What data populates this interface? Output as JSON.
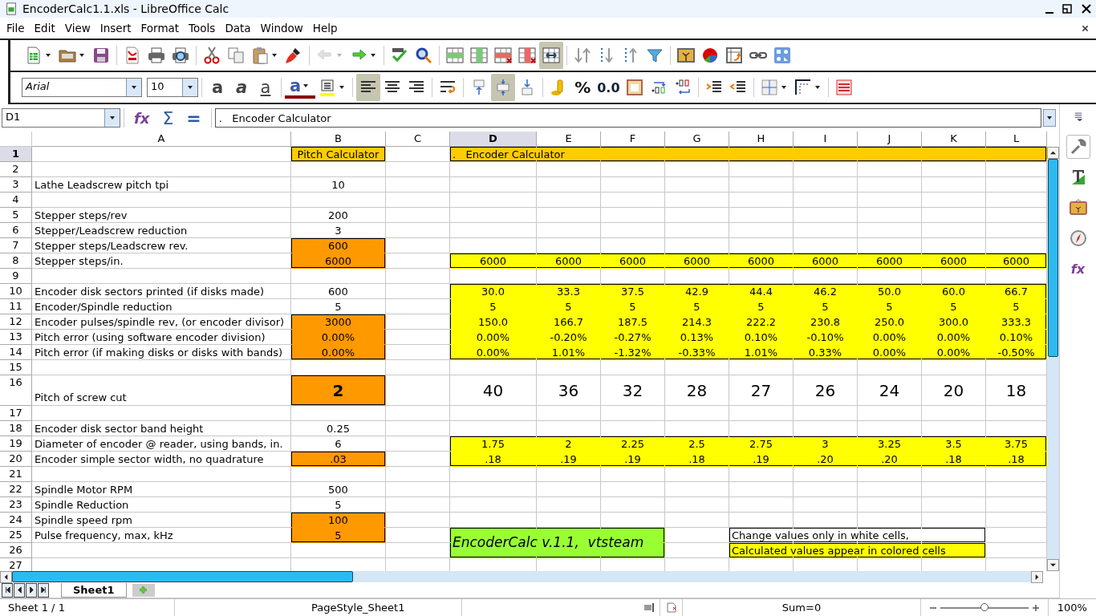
{
  "window": {
    "title": "EncoderCalc1.1.xls - LibreOffice Calc"
  },
  "menu": [
    {
      "label": "File"
    },
    {
      "label": "Edit"
    },
    {
      "label": "View"
    },
    {
      "label": "Insert"
    },
    {
      "label": "Format"
    },
    {
      "label": "Tools"
    },
    {
      "label": "Data"
    },
    {
      "label": "Window"
    },
    {
      "label": "Help"
    }
  ],
  "standard_toolbar": [
    {
      "kind": "new",
      "dropdown": true,
      "disabled": false
    },
    {
      "kind": "open",
      "dropdown": true,
      "disabled": false
    },
    {
      "kind": "save",
      "disabled": false
    },
    {
      "kind": "sep"
    },
    {
      "kind": "pdf",
      "disabled": false
    },
    {
      "kind": "print",
      "disabled": false
    },
    {
      "kind": "preview",
      "disabled": false
    },
    {
      "kind": "sep"
    },
    {
      "kind": "cut",
      "disabled": false
    },
    {
      "kind": "copy",
      "disabled": false
    },
    {
      "kind": "paste",
      "dropdown": true,
      "disabled": false
    },
    {
      "kind": "brush",
      "disabled": false
    },
    {
      "kind": "sep"
    },
    {
      "kind": "undo",
      "dropdown": true,
      "disabled": true
    },
    {
      "kind": "redo",
      "dropdown": true,
      "disabled": false
    },
    {
      "kind": "sep"
    },
    {
      "kind": "spell",
      "disabled": false
    },
    {
      "kind": "find",
      "disabled": false
    },
    {
      "kind": "sep"
    },
    {
      "kind": "insrow",
      "disabled": false,
      "on": false
    },
    {
      "kind": "inscol",
      "disabled": false,
      "on": false
    },
    {
      "kind": "delrow",
      "disabled": false,
      "on": false
    },
    {
      "kind": "delcol",
      "disabled": false,
      "on": false
    },
    {
      "kind": "merge",
      "disabled": false,
      "on": true
    },
    {
      "kind": "sep"
    },
    {
      "kind": "sort",
      "disabled": false
    },
    {
      "kind": "sortasc",
      "disabled": false
    },
    {
      "kind": "sortdesc",
      "disabled": false
    },
    {
      "kind": "filter",
      "disabled": false
    },
    {
      "kind": "sep"
    },
    {
      "kind": "image",
      "disabled": false
    },
    {
      "kind": "chart",
      "disabled": false
    },
    {
      "kind": "pivot",
      "disabled": false
    },
    {
      "kind": "link",
      "disabled": false
    },
    {
      "kind": "shapes",
      "disabled": false
    }
  ],
  "formatting_toolbar": {
    "font": "Arial",
    "size": "10",
    "buttons": [
      {
        "kind": "bold",
        "label": "a",
        "on": false
      },
      {
        "kind": "italic",
        "label": "a",
        "on": false
      },
      {
        "kind": "underline",
        "label": "a",
        "on": false
      },
      {
        "kind": "sep"
      },
      {
        "kind": "fontcolor",
        "label": "a",
        "dropdown": true,
        "on": false
      },
      {
        "kind": "highlight",
        "dropdown": true,
        "on": false
      },
      {
        "kind": "sep"
      },
      {
        "kind": "alignleft",
        "on": true
      },
      {
        "kind": "aligncenter",
        "on": false
      },
      {
        "kind": "alignright",
        "on": false
      },
      {
        "kind": "sep"
      },
      {
        "kind": "wrap",
        "on": false
      },
      {
        "kind": "sep"
      },
      {
        "kind": "valigntop",
        "on": false
      },
      {
        "kind": "valigncenter",
        "on": true
      },
      {
        "kind": "valignbottom",
        "on": false
      },
      {
        "kind": "sep"
      },
      {
        "kind": "currency",
        "on": false
      },
      {
        "kind": "percent",
        "label": "%",
        "on": false
      },
      {
        "kind": "number",
        "label": "0.0",
        "on": false
      },
      {
        "kind": "date",
        "on": false
      },
      {
        "kind": "adddec",
        "on": false
      },
      {
        "kind": "deldec",
        "on": false
      },
      {
        "kind": "sep"
      },
      {
        "kind": "indent",
        "on": false
      },
      {
        "kind": "outdent",
        "on": false
      },
      {
        "kind": "sep"
      },
      {
        "kind": "borders",
        "dropdown": true,
        "on": false
      },
      {
        "kind": "borderstyle",
        "dropdown": true,
        "on": false
      },
      {
        "kind": "sep"
      },
      {
        "kind": "conditional",
        "on": false
      }
    ]
  },
  "formula_bar": {
    "name_box": "D1",
    "buttons": [
      {
        "kind": "fx",
        "label": "fx"
      },
      {
        "kind": "sum",
        "label": "Σ"
      },
      {
        "kind": "equals",
        "label": "="
      }
    ],
    "content": ".   Encoder Calculator"
  },
  "sheet": {
    "columns": [
      {
        "label": "A",
        "selected": false
      },
      {
        "label": "B",
        "selected": false
      },
      {
        "label": "C",
        "selected": false
      },
      {
        "label": "D",
        "selected": true
      },
      {
        "label": "E",
        "selected": false
      },
      {
        "label": "F",
        "selected": false
      },
      {
        "label": "G",
        "selected": false
      },
      {
        "label": "H",
        "selected": false
      },
      {
        "label": "I",
        "selected": false
      },
      {
        "label": "J",
        "selected": false
      },
      {
        "label": "K",
        "selected": false
      },
      {
        "label": "L",
        "selected": false
      }
    ],
    "rows": [
      {
        "number": "1",
        "selected": true,
        "cells": [
          null,
          {
            "text": "Pitch Calculator",
            "color": "#ffcc00"
          },
          null,
          {
            "text": ".   Encoder Calculator",
            "color": "#ffcc00"
          },
          {
            "color": "#ffcc00"
          },
          {
            "color": "#ffcc00"
          },
          {
            "color": "#ffcc00"
          },
          {
            "color": "#ffcc00"
          },
          {
            "color": "#ffcc00"
          },
          {
            "color": "#ffcc00"
          },
          {
            "color": "#ffcc00"
          },
          {
            "color": "#ffcc00"
          }
        ]
      },
      {
        "number": "2",
        "selected": false
      },
      {
        "number": "3",
        "selected": false,
        "cells": [
          {
            "text": "Lathe Leadscrew pitch tpi"
          },
          {
            "text": "10"
          }
        ]
      },
      {
        "number": "4",
        "selected": false
      },
      {
        "number": "5",
        "selected": false,
        "cells": [
          {
            "text": "Stepper steps/rev"
          },
          {
            "text": "200"
          }
        ]
      },
      {
        "number": "6",
        "selected": false,
        "cells": [
          {
            "text": "Stepper/Leadscrew reduction"
          },
          {
            "text": "3"
          }
        ]
      },
      {
        "number": "7",
        "selected": false,
        "cells": [
          {
            "text": "Stepper steps/Leadscrew rev."
          },
          {
            "text": "600",
            "color": "#ff9900"
          }
        ]
      },
      {
        "number": "8",
        "selected": false,
        "cells": [
          {
            "text": "Stepper steps/in."
          },
          {
            "text": "6000",
            "color": "#ff9900"
          },
          null,
          {
            "text": "6000",
            "color": "#ffff00"
          },
          {
            "text": "6000",
            "color": "#ffff00"
          },
          {
            "text": "6000",
            "color": "#ffff00"
          },
          {
            "text": "6000",
            "color": "#ffff00"
          },
          {
            "text": "6000",
            "color": "#ffff00"
          },
          {
            "text": "6000",
            "color": "#ffff00"
          },
          {
            "text": "6000",
            "color": "#ffff00"
          },
          {
            "text": "6000",
            "color": "#ffff00"
          },
          {
            "text": "6000",
            "color": "#ffff00"
          }
        ]
      },
      {
        "number": "9",
        "selected": false
      },
      {
        "number": "10",
        "selected": false,
        "cells": [
          {
            "text": "Encoder disk sectors printed (if disks made)"
          },
          {
            "text": "600"
          },
          null,
          {
            "text": "30.0",
            "color": "#ffff00"
          },
          {
            "text": "33.3",
            "color": "#ffff00"
          },
          {
            "text": "37.5",
            "color": "#ffff00"
          },
          {
            "text": "42.9",
            "color": "#ffff00"
          },
          {
            "text": "44.4",
            "color": "#ffff00"
          },
          {
            "text": "46.2",
            "color": "#ffff00"
          },
          {
            "text": "50.0",
            "color": "#ffff00"
          },
          {
            "text": "60.0",
            "color": "#ffff00"
          },
          {
            "text": "66.7",
            "color": "#ffff00"
          }
        ]
      },
      {
        "number": "11",
        "selected": false,
        "cells": [
          {
            "text": "Encoder/Spindle reduction"
          },
          {
            "text": "5"
          },
          null,
          {
            "text": "5",
            "color": "#ffff00"
          },
          {
            "text": "5",
            "color": "#ffff00"
          },
          {
            "text": "5",
            "color": "#ffff00"
          },
          {
            "text": "5",
            "color": "#ffff00"
          },
          {
            "text": "5",
            "color": "#ffff00"
          },
          {
            "text": "5",
            "color": "#ffff00"
          },
          {
            "text": "5",
            "color": "#ffff00"
          },
          {
            "text": "5",
            "color": "#ffff00"
          },
          {
            "text": "5",
            "color": "#ffff00"
          }
        ]
      },
      {
        "number": "12",
        "selected": false,
        "cells": [
          {
            "text": "Encoder pulses/spindle rev, (or encoder divisor)"
          },
          {
            "text": "3000",
            "color": "#ff9900"
          },
          null,
          {
            "text": "150.0",
            "color": "#ffff00"
          },
          {
            "text": "166.7",
            "color": "#ffff00"
          },
          {
            "text": "187.5",
            "color": "#ffff00"
          },
          {
            "text": "214.3",
            "color": "#ffff00"
          },
          {
            "text": "222.2",
            "color": "#ffff00"
          },
          {
            "text": "230.8",
            "color": "#ffff00"
          },
          {
            "text": "250.0",
            "color": "#ffff00"
          },
          {
            "text": "300.0",
            "color": "#ffff00"
          },
          {
            "text": "333.3",
            "color": "#ffff00"
          }
        ]
      },
      {
        "number": "13",
        "selected": false,
        "cells": [
          {
            "text": "Pitch error (using software encoder division)"
          },
          {
            "text": "0.00%",
            "color": "#ff9900"
          },
          null,
          {
            "text": "0.00%",
            "color": "#ffff00"
          },
          {
            "text": "-0.20%",
            "color": "#ffff00"
          },
          {
            "text": "-0.27%",
            "color": "#ffff00"
          },
          {
            "text": "0.13%",
            "color": "#ffff00"
          },
          {
            "text": "0.10%",
            "color": "#ffff00"
          },
          {
            "text": "-0.10%",
            "color": "#ffff00"
          },
          {
            "text": "0.00%",
            "color": "#ffff00"
          },
          {
            "text": "0.00%",
            "color": "#ffff00"
          },
          {
            "text": "0.10%",
            "color": "#ffff00"
          }
        ]
      },
      {
        "number": "14",
        "selected": false,
        "cells": [
          {
            "text": "Pitch error (if making disks or disks with bands)"
          },
          {
            "text": "0.00%",
            "color": "#ff9900"
          },
          null,
          {
            "text": "0.00%",
            "color": "#ffff00"
          },
          {
            "text": "1.01%",
            "color": "#ffff00"
          },
          {
            "text": "-1.32%",
            "color": "#ffff00"
          },
          {
            "text": "-0.33%",
            "color": "#ffff00"
          },
          {
            "text": "1.01%",
            "color": "#ffff00"
          },
          {
            "text": "0.33%",
            "color": "#ffff00"
          },
          {
            "text": "0.00%",
            "color": "#ffff00"
          },
          {
            "text": "0.00%",
            "color": "#ffff00"
          },
          {
            "text": "-0.50%",
            "color": "#ffff00"
          }
        ]
      },
      {
        "number": "15",
        "selected": false
      },
      {
        "number": "16",
        "selected": false,
        "kind": "large",
        "cells": [
          {
            "text": "Pitch of screw cut"
          },
          {
            "text": "2",
            "color": "#ff9900",
            "bold": true
          },
          null,
          {
            "text": "40"
          },
          {
            "text": "36"
          },
          {
            "text": "32"
          },
          {
            "text": "28"
          },
          {
            "text": "27"
          },
          {
            "text": "26"
          },
          {
            "text": "24"
          },
          {
            "text": "20"
          },
          {
            "text": "18"
          }
        ]
      },
      {
        "number": "17",
        "selected": false
      },
      {
        "number": "18",
        "selected": false,
        "cells": [
          {
            "text": "Encoder disk sector band height"
          },
          {
            "text": "0.25"
          }
        ]
      },
      {
        "number": "19",
        "selected": false,
        "cells": [
          {
            "text": "Diameter of encoder @ reader, using bands, in."
          },
          {
            "text": "6"
          },
          null,
          {
            "text": "1.75",
            "color": "#ffff00"
          },
          {
            "text": "2",
            "color": "#ffff00"
          },
          {
            "text": "2.25",
            "color": "#ffff00"
          },
          {
            "text": "2.5",
            "color": "#ffff00"
          },
          {
            "text": "2.75",
            "color": "#ffff00"
          },
          {
            "text": "3",
            "color": "#ffff00"
          },
          {
            "text": "3.25",
            "color": "#ffff00"
          },
          {
            "text": "3.5",
            "color": "#ffff00"
          },
          {
            "text": "3.75",
            "color": "#ffff00"
          }
        ]
      },
      {
        "number": "20",
        "selected": false,
        "cells": [
          {
            "text": "Encoder simple sector width, no quadrature"
          },
          {
            "text": ".03",
            "color": "#ff9900"
          },
          null,
          {
            "text": ".18",
            "color": "#ffff00"
          },
          {
            "text": ".19",
            "color": "#ffff00"
          },
          {
            "text": ".19",
            "color": "#ffff00"
          },
          {
            "text": ".18",
            "color": "#ffff00"
          },
          {
            "text": ".19",
            "color": "#ffff00"
          },
          {
            "text": ".20",
            "color": "#ffff00"
          },
          {
            "text": ".20",
            "color": "#ffff00"
          },
          {
            "text": ".18",
            "color": "#ffff00"
          },
          {
            "text": ".18",
            "color": "#ffff00"
          }
        ]
      },
      {
        "number": "21",
        "selected": false
      },
      {
        "number": "22",
        "selected": false,
        "cells": [
          {
            "text": "Spindle Motor RPM"
          },
          {
            "text": "500"
          }
        ]
      },
      {
        "number": "23",
        "selected": false,
        "cells": [
          {
            "text": "Spindle Reduction"
          },
          {
            "text": "5"
          }
        ]
      },
      {
        "number": "24",
        "selected": false,
        "cells": [
          {
            "text": "Spindle speed rpm"
          },
          {
            "text": "100",
            "color": "#ff9900"
          }
        ]
      },
      {
        "number": "25",
        "selected": false,
        "cells": [
          {
            "text": "Pulse frequency, max, kHz"
          },
          {
            "text": "5",
            "color": "#ff9900"
          },
          null,
          {
            "text": "EncoderCalc v.1.1,  vtsteam",
            "color": "#99ff33",
            "italic": true
          },
          {
            "color": "#99ff33"
          },
          {
            "color": "#99ff33"
          },
          null,
          {
            "text": "Change values only in white cells,",
            "boxed": true
          },
          {
            "boxed": true
          },
          {
            "boxed": true
          },
          {
            "boxed": true
          }
        ]
      },
      {
        "number": "26",
        "selected": false,
        "cells": [
          null,
          null,
          null,
          {
            "color": "#99ff33"
          },
          {
            "color": "#99ff33"
          },
          {
            "color": "#99ff33"
          },
          null,
          {
            "text": "Calculated values appear in colored cells",
            "color": "#ffff00"
          },
          {
            "color": "#ffff00"
          },
          {
            "color": "#ffff00"
          },
          {
            "color": "#ffff00"
          }
        ]
      },
      {
        "number": "27",
        "selected": false
      }
    ]
  },
  "sidebar": [
    {
      "kind": "properties",
      "selected": true
    },
    {
      "kind": "styles",
      "selected": false
    },
    {
      "kind": "gallery",
      "selected": false
    },
    {
      "kind": "navigator",
      "selected": false
    },
    {
      "kind": "functions",
      "label": "fx",
      "selected": false
    }
  ],
  "sheet_tabs": [
    {
      "label": "Sheet1",
      "selected": true
    }
  ],
  "status_bar": {
    "sheet": "Sheet 1 / 1",
    "page_style": "PageStyle_Sheet1",
    "sum": "Sum=0",
    "zoom": "100%",
    "zoom_slider": {
      "level": 0.5
    }
  }
}
